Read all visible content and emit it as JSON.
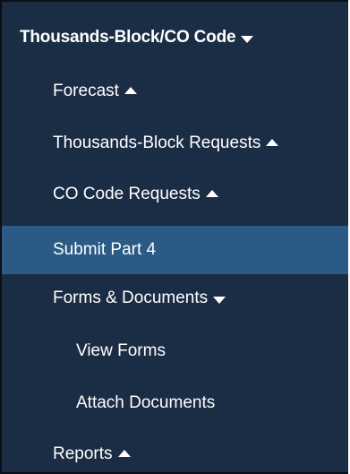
{
  "menu": {
    "section": {
      "label": "Thousands-Block/CO Code",
      "caret": "caret-down-icon"
    },
    "items": [
      {
        "label": "Forecast",
        "caret": "caret-up-icon"
      },
      {
        "label": "Thousands-Block Requests",
        "caret": "caret-up-icon"
      },
      {
        "label": "CO Code Requests",
        "caret": "caret-up-icon"
      },
      {
        "label": "Submit Part 4",
        "active": true
      },
      {
        "label": "Forms & Documents",
        "caret": "caret-down-icon"
      },
      {
        "label": "View Forms"
      },
      {
        "label": "Attach Documents"
      },
      {
        "label": "Reports",
        "caret": "caret-up-icon"
      }
    ]
  },
  "colors": {
    "menu_background": "#1b2c45",
    "active_background": "#2b5a85",
    "text": "#ffffff"
  }
}
